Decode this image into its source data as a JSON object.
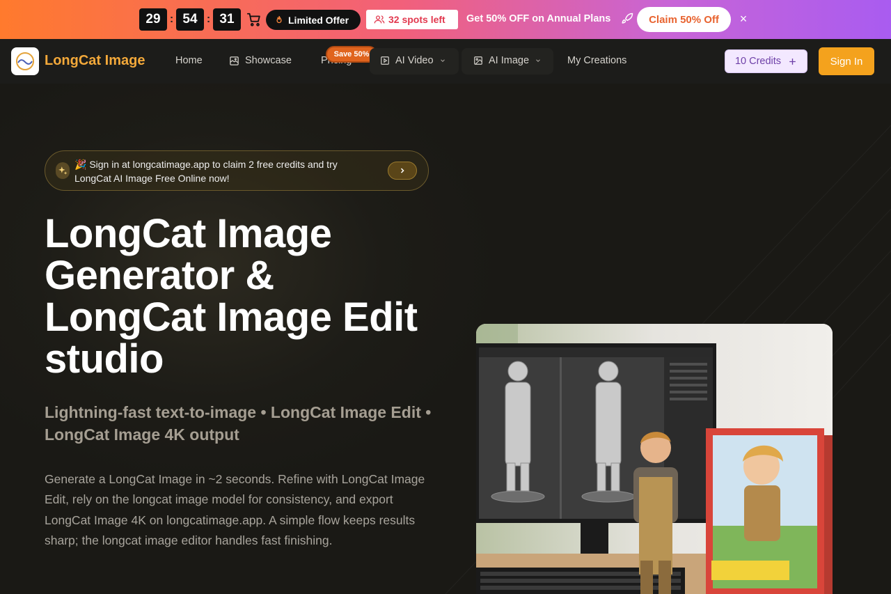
{
  "promo": {
    "timer": {
      "hours": "29",
      "minutes": "54",
      "seconds": "31",
      "separator": ":"
    },
    "limited_offer": "Limited Offer",
    "spots_left": "32 spots left",
    "annual_text": "Get 50% OFF on Annual Plans",
    "claim_button": "Claim 50% Off",
    "close_symbol": "×"
  },
  "nav": {
    "brand": "LongCat Image",
    "home": "Home",
    "showcase": "Showcase",
    "pricing": "Pricing",
    "save_badge": "Save 50%",
    "ai_video": "AI Video",
    "ai_image": "AI Image",
    "my_creations": "My Creations",
    "credits": "10 Credits",
    "sign_in": "Sign In"
  },
  "hero": {
    "notice": "🎉 Sign in at longcatimage.app to claim 2 free credits and try LongCat AI Image Free Online now!",
    "title": "LongCat Image Generator & LongCat Image Edit studio",
    "subtitle": "Lightning-fast text-to-image • LongCat Image Edit • LongCat Image 4K output",
    "description": "Generate a LongCat Image in ~2 seconds. Refine with LongCat Image Edit, rely on the longcat image model for consistency, and export LongCat Image 4K on longcatimage.app. A simple flow keeps results sharp; the longcat image editor handles fast finishing."
  },
  "colors": {
    "accent": "#f4a21d",
    "brand": "#f4a93a",
    "promo_start": "#ff7a2d",
    "promo_end": "#a95cf0"
  }
}
